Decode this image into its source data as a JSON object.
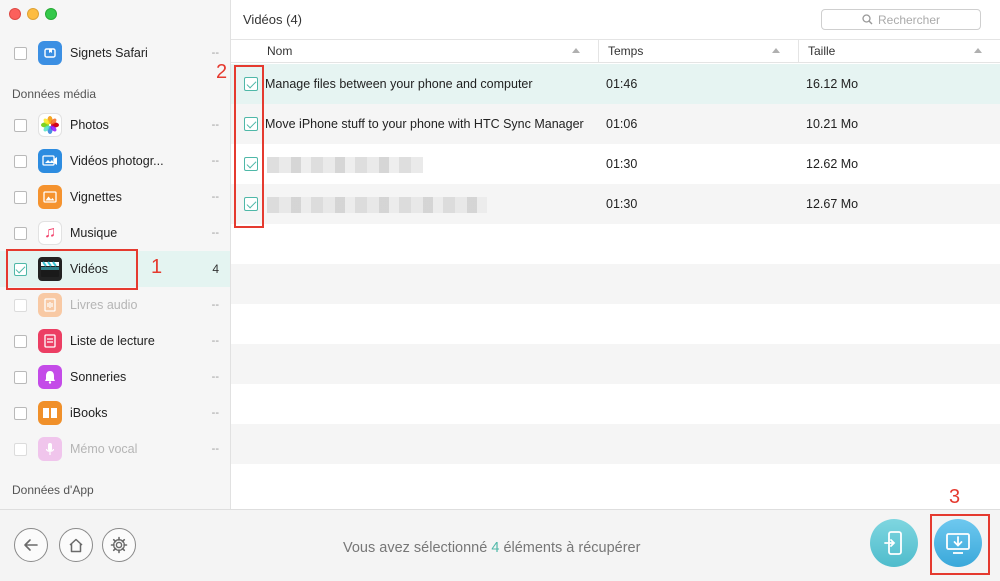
{
  "sidebar": {
    "top_item": {
      "label": "Signets Safari",
      "count": "--"
    },
    "section_media": "Données média",
    "items": [
      {
        "label": "Photos",
        "count": "--"
      },
      {
        "label": "Vidéos photogr...",
        "count": "--"
      },
      {
        "label": "Vignettes",
        "count": "--"
      },
      {
        "label": "Musique",
        "count": "--"
      },
      {
        "label": "Vidéos",
        "count": "4"
      },
      {
        "label": "Livres audio",
        "count": "--"
      },
      {
        "label": "Liste de lecture",
        "count": "--"
      },
      {
        "label": "Sonneries",
        "count": "--"
      },
      {
        "label": "iBooks",
        "count": "--"
      },
      {
        "label": "Mémo vocal",
        "count": "--"
      }
    ],
    "section_app": "Données d'App"
  },
  "main": {
    "title": "Vidéos (4)",
    "search_placeholder": "Rechercher",
    "columns": [
      "Nom",
      "Temps",
      "Taille"
    ],
    "rows": [
      {
        "name": "Manage files between your phone and computer",
        "time": "01:46",
        "size": "16.12 Mo"
      },
      {
        "name": "Move iPhone stuff to your phone with HTC Sync Manager",
        "time": "01:06",
        "size": "10.21 Mo"
      },
      {
        "name": "",
        "time": "01:30",
        "size": "12.62 Mo"
      },
      {
        "name": "",
        "time": "01:30",
        "size": "12.67 Mo"
      }
    ]
  },
  "bottom": {
    "status_prefix": "Vous avez sélectionné",
    "status_count": "4",
    "status_suffix": "éléments à récupérer"
  },
  "annotations": [
    "1",
    "2",
    "3"
  ],
  "colors": {
    "accent": "#4fb8a8",
    "annotation": "#e53a2f",
    "selected_row": "#e6f4f2"
  }
}
